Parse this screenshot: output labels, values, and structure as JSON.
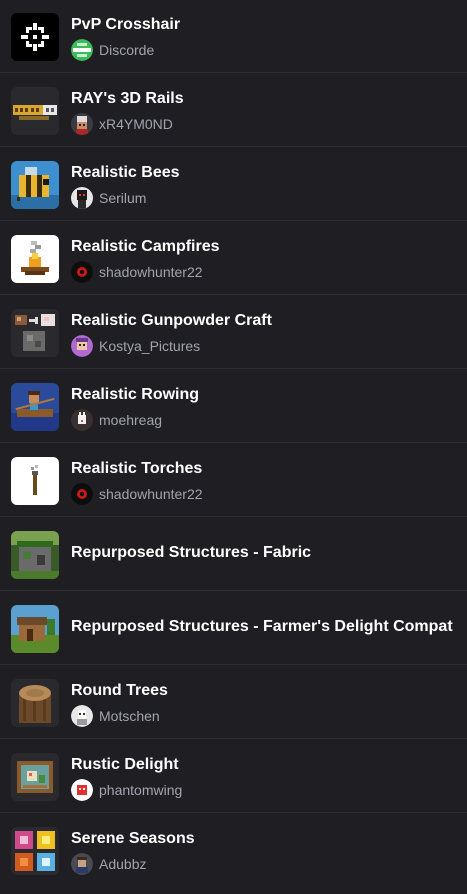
{
  "mods": [
    {
      "title": "PvP Crosshair",
      "author": "Discorde",
      "icon": "crosshair-icon",
      "avatar": "discorde-avatar"
    },
    {
      "title": "RAY's 3D Rails",
      "author": "xR4YM0ND",
      "icon": "rays-3d-rails-logo",
      "avatar": "xr4ym0nd-avatar"
    },
    {
      "title": "Realistic Bees",
      "author": "Serilum",
      "icon": "bee-icon",
      "avatar": "serilum-avatar"
    },
    {
      "title": "Realistic Campfires",
      "author": "shadowhunter22",
      "icon": "campfire-icon",
      "avatar": "shadowhunter22-avatar"
    },
    {
      "title": "Realistic Gunpowder Craft",
      "author": "Kostya_Pictures",
      "icon": "gunpowder-craft-icon",
      "avatar": "kostya-pictures-avatar"
    },
    {
      "title": "Realistic Rowing",
      "author": "moehreag",
      "icon": "rowing-boat-icon",
      "avatar": "moehreag-avatar"
    },
    {
      "title": "Realistic Torches",
      "author": "shadowhunter22",
      "icon": "torch-icon",
      "avatar": "shadowhunter22-avatar"
    },
    {
      "title": "Repurposed Structures - Fabric",
      "author": "",
      "icon": "jungle-structure-icon",
      "avatar": ""
    },
    {
      "title": "Repurposed Structures - Farmer's Delight Compat",
      "author": "",
      "icon": "farmhouse-structure-icon",
      "avatar": ""
    },
    {
      "title": "Round Trees",
      "author": "Motschen",
      "icon": "log-icon",
      "avatar": "motschen-avatar"
    },
    {
      "title": "Rustic Delight",
      "author": "phantomwing",
      "icon": "rustic-painting-icon",
      "avatar": "phantomwing-avatar"
    },
    {
      "title": "Serene Seasons",
      "author": "Adubbz",
      "icon": "seasons-icon",
      "avatar": "adubbz-avatar"
    }
  ],
  "colors": {
    "background": "#1f1f23",
    "divider": "#2e2e33",
    "title_text": "#ffffff",
    "author_text": "#a3a3ad"
  }
}
